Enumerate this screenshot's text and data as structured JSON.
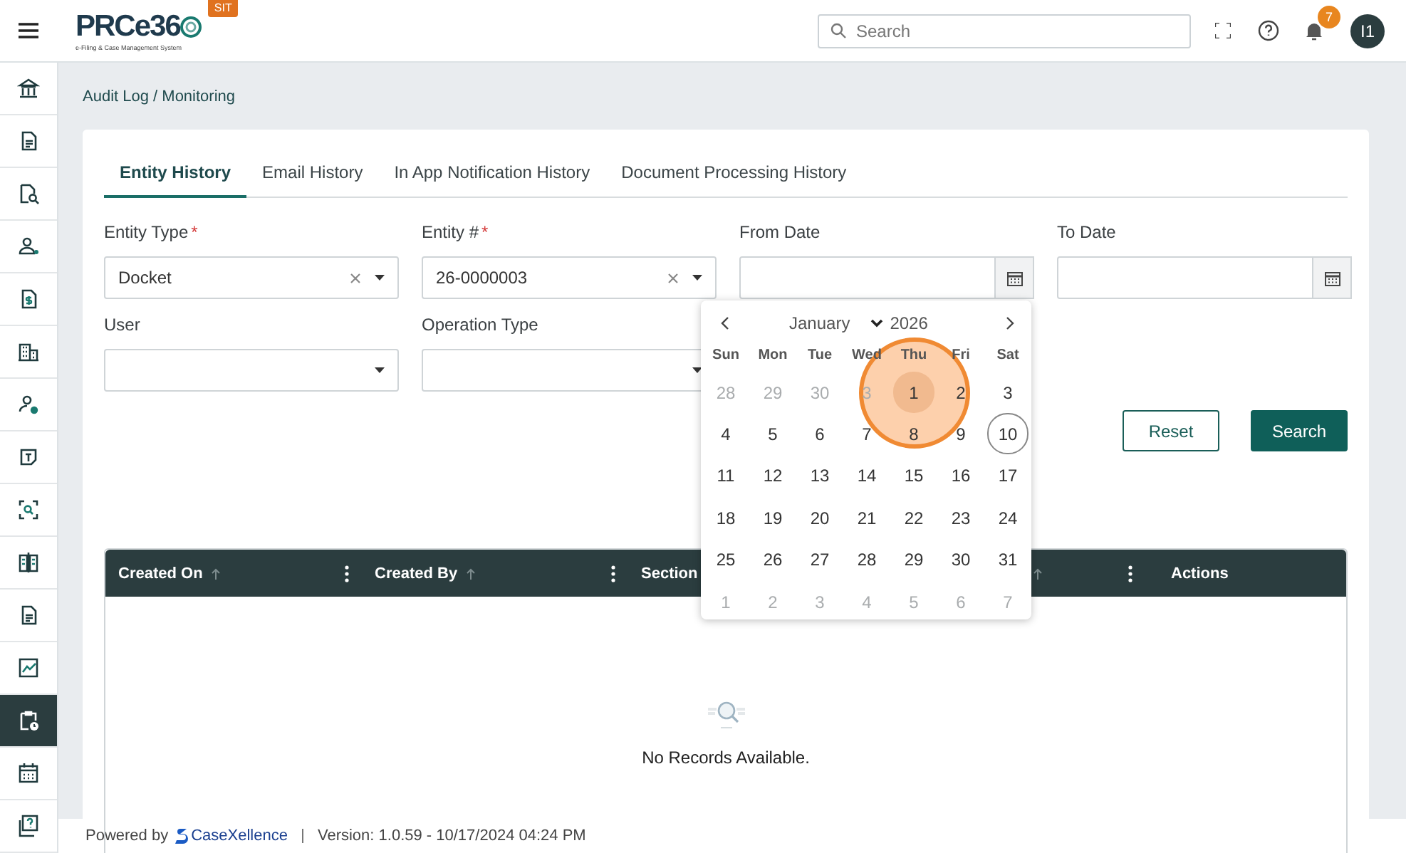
{
  "header": {
    "logo": "PRCe36",
    "logo_subtitle": "e-Filing & Case Management System",
    "env_badge": "SIT",
    "search": {
      "placeholder": "Search"
    },
    "notification_count": "7",
    "avatar": "I1"
  },
  "sidebar": {
    "items": [
      {
        "selected": false
      },
      {
        "selected": false
      },
      {
        "selected": false
      },
      {
        "selected": false
      },
      {
        "selected": false
      },
      {
        "selected": false
      },
      {
        "selected": false
      },
      {
        "selected": false
      },
      {
        "selected": false
      },
      {
        "selected": false
      },
      {
        "selected": false
      },
      {
        "selected": false
      },
      {
        "selected": true
      },
      {
        "selected": false
      },
      {
        "selected": false
      }
    ]
  },
  "breadcrumb": "Audit Log / Monitoring",
  "tabs": [
    {
      "label": "Entity History",
      "selected": true
    },
    {
      "label": "Email History",
      "selected": false
    },
    {
      "label": "In App Notification History",
      "selected": false
    },
    {
      "label": "Document Processing History",
      "selected": false
    }
  ],
  "fields": [
    {
      "kind": "select",
      "label": "Entity Type",
      "required_mark": "*",
      "value": "Docket",
      "clearable": true
    },
    {
      "kind": "select",
      "label": "Entity #",
      "required_mark": "*",
      "value": "26-0000003",
      "clearable": true
    },
    {
      "kind": "date",
      "label": "From Date",
      "calendar_open": true
    },
    {
      "kind": "date",
      "label": "To Date"
    },
    {
      "kind": "select",
      "label": "User"
    },
    {
      "kind": "select",
      "label": "Operation Type"
    }
  ],
  "buttons": [
    {
      "kind": "outline",
      "label": "Reset"
    },
    {
      "kind": "primary",
      "label": "Search"
    }
  ],
  "table": {
    "columns": [
      {
        "label": "Created On",
        "sortable": true,
        "menu": true
      },
      {
        "label": "Created By",
        "sortable": true,
        "menu": true
      },
      {
        "label": "Section"
      },
      {
        "sortable": true,
        "menu": true
      },
      {
        "label": "Actions"
      }
    ],
    "empty_message": "No Records Available."
  },
  "calendar": {
    "month": "January",
    "year": "2026",
    "weekdays": [
      "Sun",
      "Mon",
      "Tue",
      "Wed",
      "Thu",
      "Fri",
      "Sat"
    ],
    "weeks": [
      [
        {
          "label": "28",
          "outside": true,
          "today": false,
          "clicked": false
        },
        {
          "label": "29",
          "outside": true,
          "today": false,
          "clicked": false
        },
        {
          "label": "30",
          "outside": true,
          "today": false,
          "clicked": false
        },
        {
          "label": "3",
          "outside": true,
          "today": false,
          "clicked": false
        },
        {
          "label": "1",
          "outside": false,
          "today": false,
          "clicked": true
        },
        {
          "label": "2",
          "outside": false,
          "today": false,
          "clicked": false
        },
        {
          "label": "3",
          "outside": false,
          "today": false,
          "clicked": false
        }
      ],
      [
        {
          "label": "4",
          "outside": false,
          "today": false,
          "clicked": false
        },
        {
          "label": "5",
          "outside": false,
          "today": false,
          "clicked": false
        },
        {
          "label": "6",
          "outside": false,
          "today": false,
          "clicked": false
        },
        {
          "label": "7",
          "outside": false,
          "today": false,
          "clicked": false
        },
        {
          "label": "8",
          "outside": false,
          "today": false,
          "clicked": false
        },
        {
          "label": "9",
          "outside": false,
          "today": false,
          "clicked": false
        },
        {
          "label": "10",
          "outside": false,
          "today": true,
          "clicked": false
        }
      ],
      [
        {
          "label": "11",
          "outside": false,
          "today": false,
          "clicked": false
        },
        {
          "label": "12",
          "outside": false,
          "today": false,
          "clicked": false
        },
        {
          "label": "13",
          "outside": false,
          "today": false,
          "clicked": false
        },
        {
          "label": "14",
          "outside": false,
          "today": false,
          "clicked": false
        },
        {
          "label": "15",
          "outside": false,
          "today": false,
          "clicked": false
        },
        {
          "label": "16",
          "outside": false,
          "today": false,
          "clicked": false
        },
        {
          "label": "17",
          "outside": false,
          "today": false,
          "clicked": false
        }
      ],
      [
        {
          "label": "18",
          "outside": false,
          "today": false,
          "clicked": false
        },
        {
          "label": "19",
          "outside": false,
          "today": false,
          "clicked": false
        },
        {
          "label": "20",
          "outside": false,
          "today": false,
          "clicked": false
        },
        {
          "label": "21",
          "outside": false,
          "today": false,
          "clicked": false
        },
        {
          "label": "22",
          "outside": false,
          "today": false,
          "clicked": false
        },
        {
          "label": "23",
          "outside": false,
          "today": false,
          "clicked": false
        },
        {
          "label": "24",
          "outside": false,
          "today": false,
          "clicked": false
        }
      ],
      [
        {
          "label": "25",
          "outside": false,
          "today": false,
          "clicked": false
        },
        {
          "label": "26",
          "outside": false,
          "today": false,
          "clicked": false
        },
        {
          "label": "27",
          "outside": false,
          "today": false,
          "clicked": false
        },
        {
          "label": "28",
          "outside": false,
          "today": false,
          "clicked": false
        },
        {
          "label": "29",
          "outside": false,
          "today": false,
          "clicked": false
        },
        {
          "label": "30",
          "outside": false,
          "today": false,
          "clicked": false
        },
        {
          "label": "31",
          "outside": false,
          "today": false,
          "clicked": false
        }
      ],
      [
        {
          "label": "1",
          "outside": true,
          "today": false,
          "clicked": false
        },
        {
          "label": "2",
          "outside": true,
          "today": false,
          "clicked": false
        },
        {
          "label": "3",
          "outside": true,
          "today": false,
          "clicked": false
        },
        {
          "label": "4",
          "outside": true,
          "today": false,
          "clicked": false
        },
        {
          "label": "5",
          "outside": true,
          "today": false,
          "clicked": false
        },
        {
          "label": "6",
          "outside": true,
          "today": false,
          "clicked": false
        },
        {
          "label": "7",
          "outside": true,
          "today": false,
          "clicked": false
        }
      ]
    ]
  },
  "footer": {
    "powered_by": "Powered by",
    "brand": "CaseXellence",
    "version": "Version: 1.0.59 - 10/17/2024 04:24 PM"
  }
}
